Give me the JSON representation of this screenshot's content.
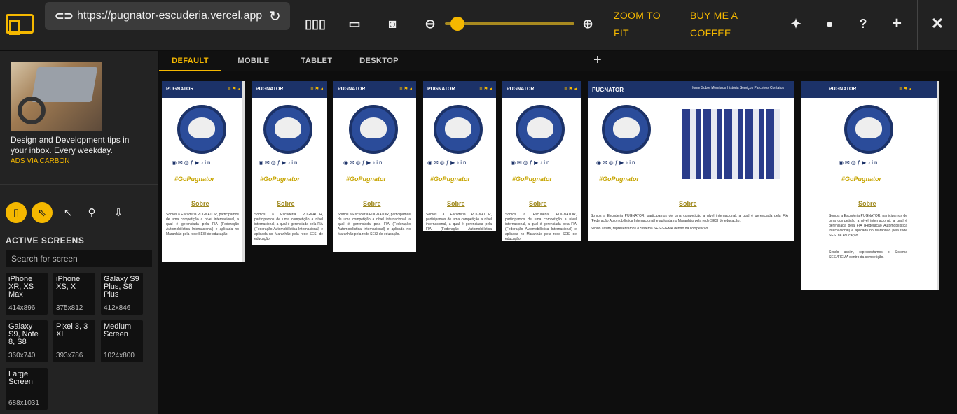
{
  "topbar": {
    "url": "https://pugnator-escuderia.vercel.app",
    "zoom_to_fit": "ZOOM TO FIT",
    "buy_coffee": "BUY ME A COFFEE"
  },
  "ad": {
    "text": "Design and Development tips in your inbox. Every weekday.",
    "link": "ADS VIA CARBON"
  },
  "sidebar": {
    "title": "ACTIVE SCREENS",
    "search_placeholder": "Search for screen",
    "devices": [
      {
        "name": "iPhone XR, XS Max",
        "size": "414x896"
      },
      {
        "name": "iPhone XS, X",
        "size": "375x812"
      },
      {
        "name": "Galaxy S9 Plus, S8 Plus",
        "size": "412x846"
      },
      {
        "name": "Galaxy S9, Note 8, S8",
        "size": "360x740"
      },
      {
        "name": "Pixel 3, 3 XL",
        "size": "393x786"
      },
      {
        "name": "Medium Screen",
        "size": "1024x800"
      },
      {
        "name": "Large Screen",
        "size": "688x1031"
      }
    ]
  },
  "tabs": {
    "default": "DEFAULT",
    "mobile": "MOBILE",
    "tablet": "TABLET",
    "desktop": "DESKTOP"
  },
  "site": {
    "brand": "PUGNATOR",
    "tag": "#GoPugnator",
    "section": "Sobre",
    "nav": "Home Sobre Membros História Serviços Parceiros Contatos",
    "para1": "Somos a Escuderia PUGNATOR, participamos de uma competição a nível internacional, a qual é gerenciada pela FIA (Federação Automobilística Internacional) e aplicada no Maranhão pela rede SESI de educação.",
    "para2": "Sendo assim, representamos o Sistema SESI/FIEMA dentro da competição."
  }
}
